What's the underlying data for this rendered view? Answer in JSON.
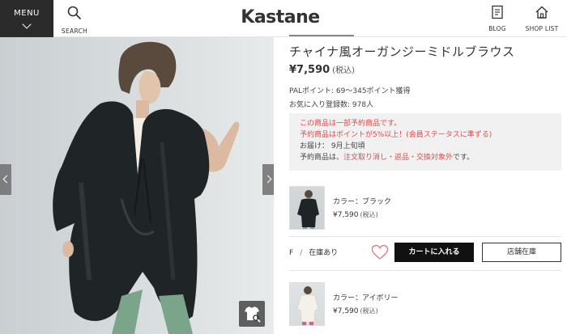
{
  "header": {
    "menu_label": "MENU",
    "search_label": "SEARCH",
    "logo": "Kastane",
    "blog_label": "BLOG",
    "shop_list_label": "SHOP LIST"
  },
  "product": {
    "title": "チャイナ風オーガンジーミドルブラウス",
    "price": "¥7,590",
    "tax_note": "(税込)",
    "points": "PALポイント: 69～345ポイント獲得",
    "favorites": "お気に入り登録数: 978人"
  },
  "notice": {
    "line1": "この商品は一部予約商品です。",
    "line2": "予約商品はポイントが5%以上！(会員ステータスに準ずる)",
    "line3": "お届け： 9月上旬頃",
    "line4_prefix": "予約商品は、",
    "line4_highlight": "注文取り消し・返品・交換対象外",
    "line4_suffix": "です。"
  },
  "variants": [
    {
      "color": "カラー：ブラック",
      "price": "¥7,590",
      "tax": "(税込)"
    },
    {
      "color": "カラー：アイボリー",
      "price": "¥7,590",
      "tax": "(税込)"
    }
  ],
  "stock": {
    "size": "F",
    "separator": "/",
    "status": "在庫あり",
    "cart_label": "カートに入れる",
    "store_label": "店舗在庫"
  },
  "colors": {
    "header_dark": "#2b2b2b",
    "notice_red": "#e04a4a",
    "cart_bg": "#111111",
    "heart": "#e57a8c"
  }
}
